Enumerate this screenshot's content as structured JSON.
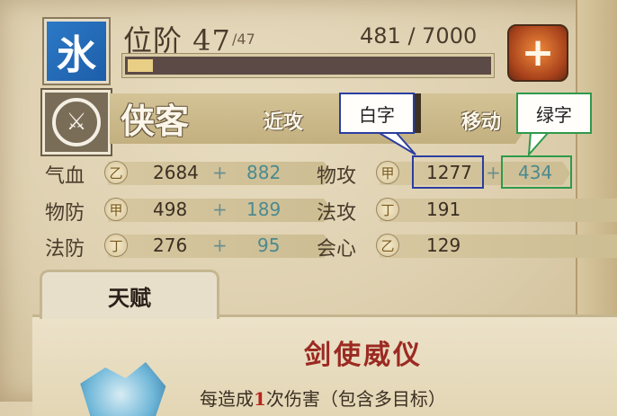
{
  "header": {
    "class_icon_glyph": "氷",
    "rank_label": "位阶 47",
    "rank_max": "/47",
    "exp_text": "481 / 7000",
    "exp_progress": 0.069,
    "plus_button_label": "+"
  },
  "hero": {
    "name": "侠客",
    "attack_type": "近攻",
    "move_label": "移动"
  },
  "stats": {
    "hp": {
      "label": "气血",
      "grade": "乙",
      "base": "2684",
      "plus": "+",
      "bonus": "882"
    },
    "phys_atk": {
      "label": "物攻",
      "grade": "甲",
      "base": "1277",
      "plus": "+",
      "bonus": "434"
    },
    "phys_def": {
      "label": "物防",
      "grade": "甲",
      "base": "498",
      "plus": "+",
      "bonus": "189"
    },
    "magic_atk": {
      "label": "法攻",
      "grade": "丁",
      "base": "191"
    },
    "magic_def": {
      "label": "法防",
      "grade": "丁",
      "base": "276",
      "plus": "+",
      "bonus": "95"
    },
    "crit": {
      "label": "会心",
      "grade": "乙",
      "base": "129"
    }
  },
  "annotations": {
    "white_label": "白字",
    "green_label": "绿字",
    "white_color": "#2b3ea0",
    "green_color": "#2e9a4a"
  },
  "talent": {
    "tab_label": "天赋",
    "skill_title": "剑使威仪",
    "desc_prefix": "每造成",
    "desc_highlight": "1",
    "desc_suffix": "次伤害（包含多目标）"
  },
  "colors": {
    "bonus_text": "#4b8a8f",
    "skill_title": "#9b2a22"
  }
}
